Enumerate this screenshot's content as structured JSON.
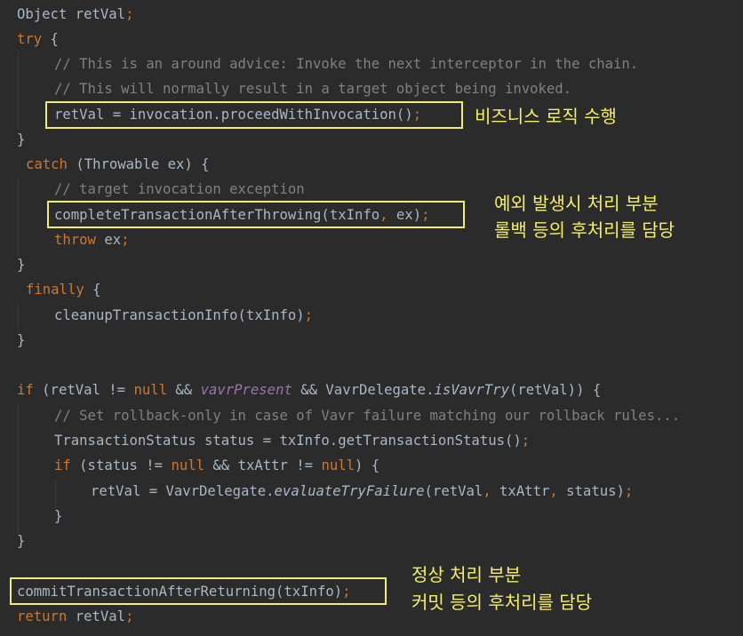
{
  "code": {
    "l1": {
      "a": "Object retVal",
      "b": ";"
    },
    "l2": {
      "kw": "try",
      "rest": " {"
    },
    "l3": "// This is an around advice: Invoke the next interceptor in the chain.",
    "l4": "// This will normally result in a target object being invoked.",
    "l5": {
      "a": "retVal = invocation.proceedWithInvocation()",
      "b": ";"
    },
    "l6": "}",
    "l7": {
      "kw": "catch",
      "rest": " (Throwable ex) {"
    },
    "l8": "// target invocation exception",
    "l9": {
      "a": "completeTransactionAfterThrowing(txInfo",
      "comma": ",",
      "b": " ex)",
      "semi": ";"
    },
    "l10": {
      "kw": "throw",
      "rest": " ex",
      "semi": ";"
    },
    "l11": "}",
    "l12": {
      "kw": "finally",
      "rest": " {"
    },
    "l13": {
      "a": "cleanupTransactionInfo(txInfo)",
      "semi": ";"
    },
    "l14": "}",
    "l16": {
      "kw": "if",
      "p1": " (retVal != ",
      "null": "null",
      "p2": " && ",
      "fld": "vavrPresent",
      "p3": " && VavrDelegate.",
      "st": "isVavrTry",
      "p4": "(retVal)) {"
    },
    "l17": "// Set rollback-only in case of Vavr failure matching our rollback rules...",
    "l18": {
      "a": "TransactionStatus status = txInfo.getTransactionStatus()",
      "semi": ";"
    },
    "l19": {
      "kw": "if",
      "p1": " (status != ",
      "null1": "null",
      "p2": " && txAttr != ",
      "null2": "null",
      "p3": ") {"
    },
    "l20": {
      "a": "retVal = VavrDelegate.",
      "st": "evaluateTryFailure",
      "b": "(retVal",
      "c1": ",",
      "c": " txAttr",
      "c2": ",",
      "d": " status)",
      "semi": ";"
    },
    "l21": "}",
    "l22": "}",
    "l24": {
      "a": "commitTransactionAfterReturning(txInfo)",
      "semi": ";"
    },
    "l25": {
      "kw": "return",
      "rest": " retVal",
      "semi": ";"
    }
  },
  "annotations": {
    "business": "비즈니스 로직 수행",
    "exception_line1": "예외 발생시 처리 부분",
    "exception_line2": "롤백 등의 후처리를 담당",
    "normal_line1": "정상 처리 부분",
    "normal_line2": "커밋 등의 후처리를 담당"
  },
  "colors": {
    "background": "#2b2b2b",
    "keyword": "#cc7832",
    "comment": "#808080",
    "highlight_box": "#f2ec7b",
    "annotation_text": "#f5ef6a"
  }
}
